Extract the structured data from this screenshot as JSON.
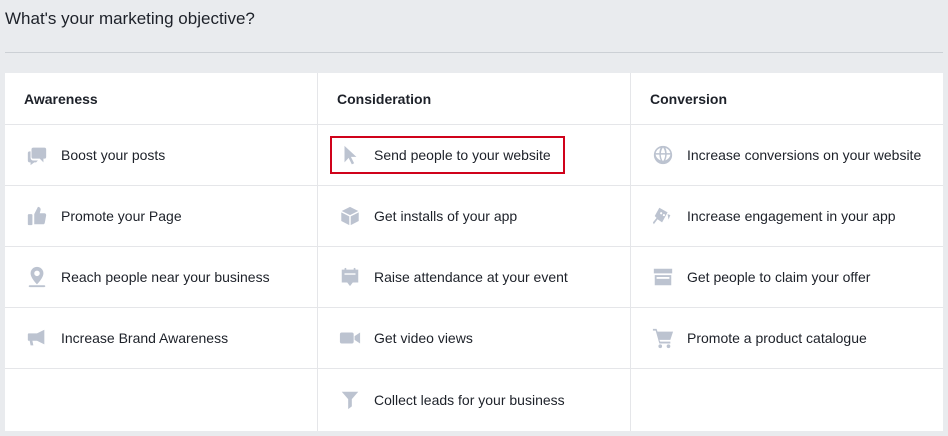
{
  "page": {
    "title": "What's your marketing objective?"
  },
  "columns": [
    {
      "header": "Awareness",
      "items": [
        {
          "label": "Boost your posts",
          "icon": "speech-bubbles-icon"
        },
        {
          "label": "Promote your Page",
          "icon": "thumbs-up-icon"
        },
        {
          "label": "Reach people near your business",
          "icon": "map-pin-icon"
        },
        {
          "label": "Increase Brand Awareness",
          "icon": "megaphone-icon"
        }
      ]
    },
    {
      "header": "Consideration",
      "items": [
        {
          "label": "Send people to your website",
          "icon": "cursor-icon",
          "selected": true
        },
        {
          "label": "Get installs of your app",
          "icon": "box-icon"
        },
        {
          "label": "Raise attendance at your event",
          "icon": "calendar-icon"
        },
        {
          "label": "Get video views",
          "icon": "video-camera-icon"
        },
        {
          "label": "Collect leads for your business",
          "icon": "funnel-icon"
        }
      ]
    },
    {
      "header": "Conversion",
      "items": [
        {
          "label": "Increase conversions on your website",
          "icon": "globe-icon"
        },
        {
          "label": "Increase engagement in your app",
          "icon": "gamepad-icon"
        },
        {
          "label": "Get people to claim your offer",
          "icon": "storefront-icon"
        },
        {
          "label": "Promote a product catalogue",
          "icon": "shopping-cart-icon"
        }
      ]
    }
  ],
  "colors": {
    "selected_border": "#d0021b",
    "icon": "#bcc3d0",
    "background": "#e9ebee"
  }
}
